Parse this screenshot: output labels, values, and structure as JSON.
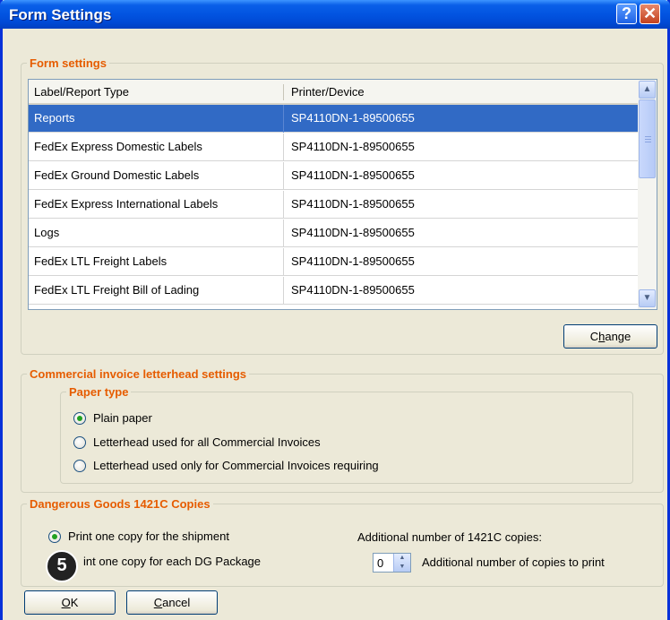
{
  "window": {
    "title": "Form Settings",
    "help_glyph": "?",
    "close_glyph": "✕"
  },
  "form_settings": {
    "legend": "Form settings",
    "columns": [
      "Label/Report Type",
      "Printer/Device"
    ],
    "rows": [
      {
        "type": "Reports",
        "device": "SP4110DN-1-89500655",
        "selected": true
      },
      {
        "type": "FedEx Express Domestic Labels",
        "device": "SP4110DN-1-89500655"
      },
      {
        "type": "FedEx Ground Domestic Labels",
        "device": "SP4110DN-1-89500655"
      },
      {
        "type": "FedEx Express International Labels",
        "device": "SP4110DN-1-89500655"
      },
      {
        "type": "Logs",
        "device": "SP4110DN-1-89500655"
      },
      {
        "type": "FedEx LTL Freight Labels",
        "device": "SP4110DN-1-89500655"
      },
      {
        "type": "FedEx LTL Freight Bill of Lading",
        "device": "SP4110DN-1-89500655"
      }
    ],
    "change_label_prefix": "C",
    "change_label_underlined": "h",
    "change_label_suffix": "ange"
  },
  "commercial_invoice": {
    "legend": "Commercial invoice letterhead settings",
    "paper_type": {
      "legend": "Paper type",
      "options": [
        {
          "label": "Plain paper",
          "selected": true
        },
        {
          "label": "Letterhead used for all Commercial Invoices",
          "selected": false
        },
        {
          "label": "Letterhead used only for Commercial Invoices requiring",
          "selected": false
        }
      ]
    }
  },
  "dangerous_goods": {
    "legend": "Dangerous Goods 1421C Copies",
    "options": [
      {
        "label": "Print one copy for the shipment",
        "selected": true
      },
      {
        "label": "int one copy for each DG Package",
        "selected": false
      }
    ],
    "additional_label": "Additional number of 1421C copies:",
    "copies_value": "0",
    "copies_caption": "Additional number of copies to print"
  },
  "buttons": {
    "ok_underlined": "O",
    "ok_suffix": "K",
    "cancel_underlined": "C",
    "cancel_suffix": "ancel"
  },
  "callout_badge": "5",
  "colors": {
    "accent": "#e65c00",
    "selection": "#316ac5",
    "titlebar": "#0254e1"
  }
}
